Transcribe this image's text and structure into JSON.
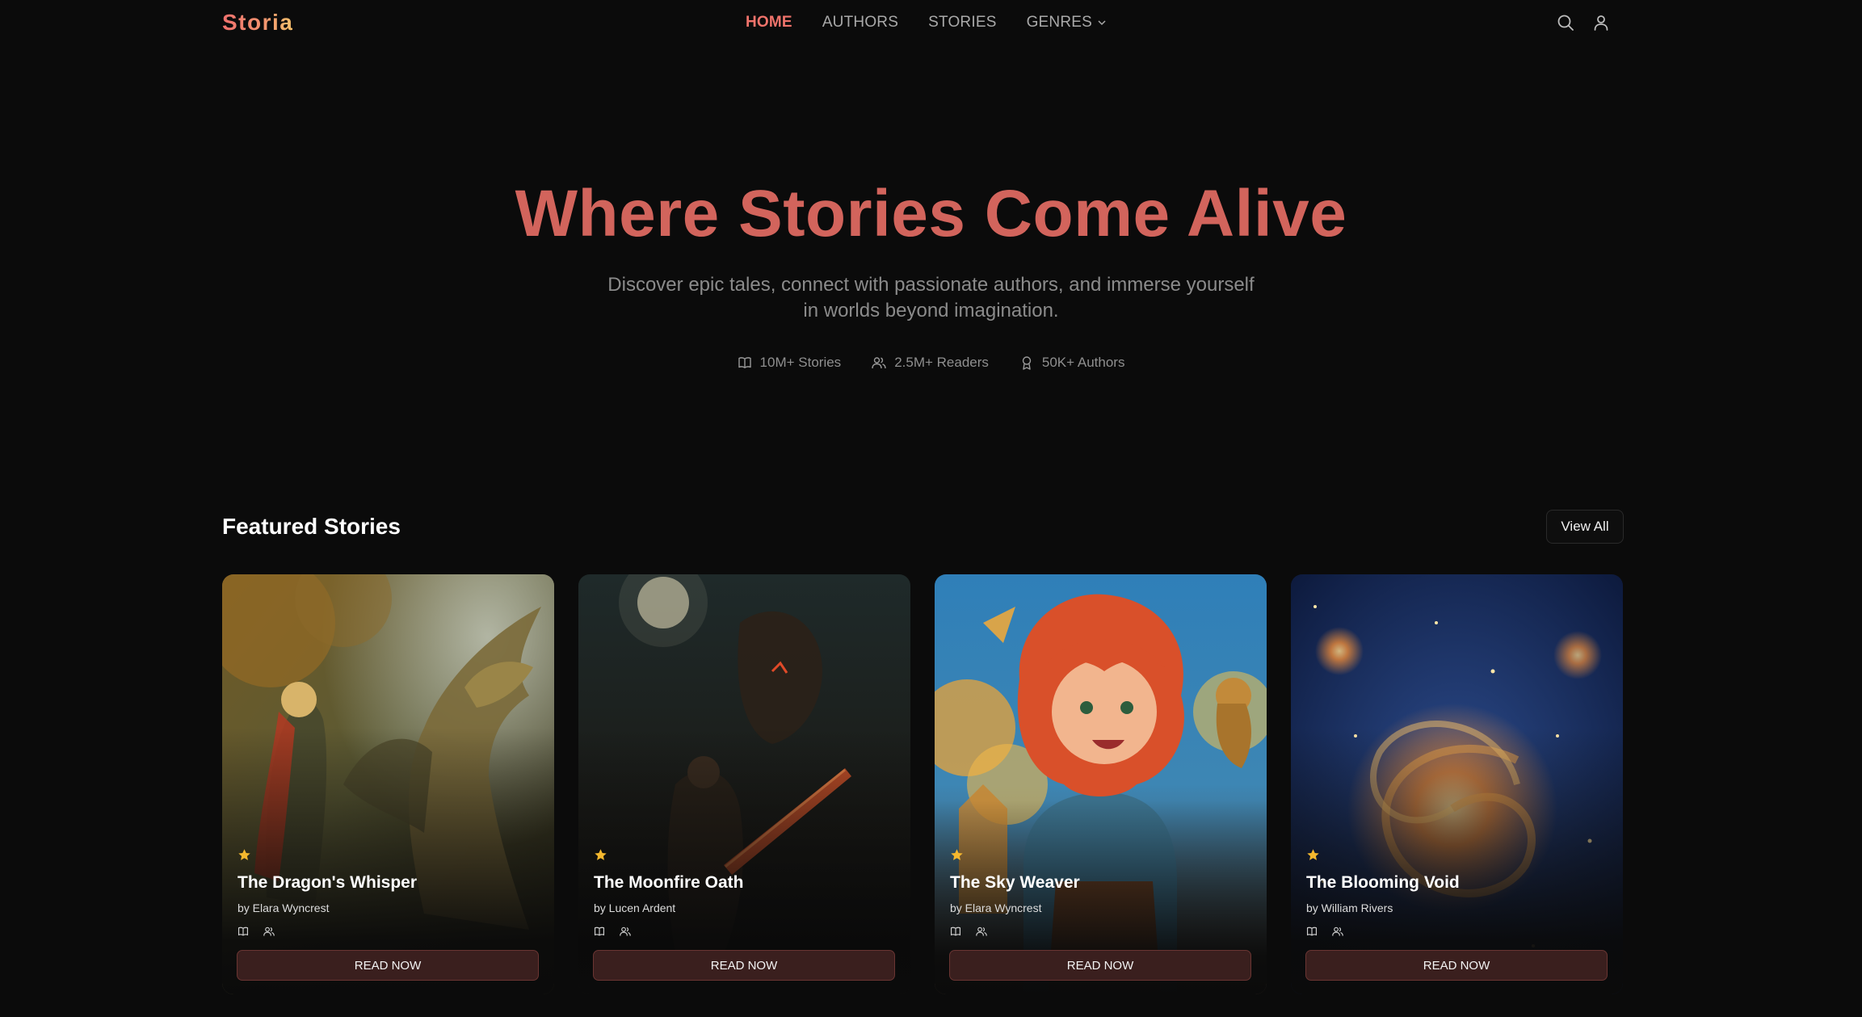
{
  "brand": {
    "logo": "Storia"
  },
  "nav": {
    "items": [
      {
        "label": "HOME",
        "active": true
      },
      {
        "label": "AUTHORS",
        "active": false
      },
      {
        "label": "STORIES",
        "active": false
      },
      {
        "label": "GENRES",
        "active": false,
        "dropdown": true
      }
    ]
  },
  "header_icons": [
    "search-icon",
    "user-icon"
  ],
  "hero": {
    "title": "Where Stories Come Alive",
    "subtitle": "Discover epic tales, connect with passionate authors, and immerse yourself in worlds beyond imagination.",
    "stats": [
      {
        "icon": "book-icon",
        "label": "10M+ Stories"
      },
      {
        "icon": "users-icon",
        "label": "2.5M+ Readers"
      },
      {
        "icon": "award-icon",
        "label": "50K+ Authors"
      }
    ]
  },
  "featured": {
    "title": "Featured Stories",
    "view_all": "View All",
    "cards": [
      {
        "title": "The Dragon's Whisper",
        "author": "by Elara Wyncrest",
        "button": "READ NOW",
        "art": "forest-dragon"
      },
      {
        "title": "The Moonfire Oath",
        "author": "by Lucen Ardent",
        "button": "READ NOW",
        "art": "moonlit-warrior"
      },
      {
        "title": "The Sky Weaver",
        "author": "by Elara Wyncrest",
        "button": "READ NOW",
        "art": "red-haired-girl"
      },
      {
        "title": "The Blooming Void",
        "author": "by William Rivers",
        "button": "READ NOW",
        "art": "spiral-galaxy"
      }
    ]
  },
  "colors": {
    "accent": "#f0736b",
    "hero_title": "#d2645c",
    "background": "#0b0b0b",
    "button_bg": "#3a1f1e",
    "star": "#f5b82e"
  }
}
